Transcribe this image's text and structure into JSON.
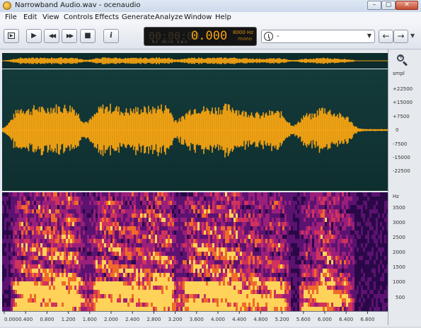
{
  "window": {
    "title": "Narrowband Audio.wav - ocenaudio",
    "controls": {
      "minimize": "–",
      "maximize": "▢",
      "close": "✕"
    }
  },
  "menu": [
    "File",
    "Edit",
    "View",
    "Controls",
    "Effects",
    "Generate",
    "Analyze",
    "Window",
    "Help"
  ],
  "toolbar": {
    "buttons": [
      {
        "name": "play-selection-button",
        "glyph": "▶"
      },
      {
        "name": "play-button",
        "glyph": "▶"
      },
      {
        "name": "rewind-button",
        "glyph": "◀◀"
      },
      {
        "name": "fast-forward-button",
        "glyph": "▶▶"
      },
      {
        "name": "stop-button",
        "glyph": "■"
      },
      {
        "name": "info-button",
        "glyph": "i"
      }
    ],
    "time_display": {
      "ghost": "00:00:00",
      "value": "0.000",
      "units": "hr  min sec",
      "rate": "8000 Hz",
      "channels": "mono"
    },
    "history_dropdown": {
      "value": "-"
    },
    "nav": {
      "back": "←",
      "forward": "→"
    }
  },
  "amplitude_scale": {
    "unit": "smpl",
    "ticks": [
      "+22500",
      "+15000",
      "+7500",
      "0",
      "-7500",
      "-15000",
      "-22500"
    ]
  },
  "frequency_scale": {
    "unit": "Hz",
    "ticks": [
      "3500",
      "3000",
      "2500",
      "2000",
      "1500",
      "1000",
      "500"
    ]
  },
  "time_scale": {
    "ticks": [
      "0.000",
      "0.400",
      "0.800",
      "1.200",
      "1.600",
      "2.000",
      "2.400",
      "2.800",
      "3.200",
      "3.600",
      "4.000",
      "4.400",
      "4.800",
      "5.200",
      "5.600",
      "6.000",
      "6.400",
      "6.800"
    ]
  },
  "colors": {
    "waveform": "#f5a312",
    "overview_bg": "#0c2b2b",
    "wave_bg": "#143a3a",
    "spectro_low": "#10042a",
    "spectro_mid": "#7a1a8c",
    "spectro_high": "#ffcc44"
  }
}
